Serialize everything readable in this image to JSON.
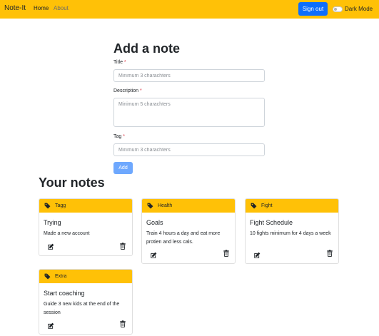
{
  "navbar": {
    "brand": "Note-It",
    "links": [
      "Home",
      "About"
    ],
    "signout_label": "Sign out",
    "dark_mode_label": "Dark Mode",
    "dark_mode_enabled": false
  },
  "form": {
    "heading": "Add a note",
    "title_label": "Title",
    "title_placeholder": "Minimum 3 charachters",
    "description_label": "Description",
    "description_placeholder": "Minimum 5 charachters",
    "tag_label": "Tag",
    "tag_placeholder": "Minimum 3 charachters",
    "required_mark": "*",
    "add_label": "Add"
  },
  "notes": {
    "heading": "Your notes",
    "items": [
      {
        "tag": "Tagg",
        "title": "Trying",
        "description": "Made a new account"
      },
      {
        "tag": "Health",
        "title": "Goals",
        "description": "Train 4 hours a day and eat more protien and less cals."
      },
      {
        "tag": "Fight",
        "title": "Fight Schedule",
        "description": "10 fights minimum for 4 days a week"
      },
      {
        "tag": "Extra",
        "title": "Start coaching",
        "description": "Guide 3 new kids at the end of the session"
      }
    ]
  },
  "colors": {
    "navbar": "#ffc107",
    "primary": "#0d6efd",
    "add_button": "#6ea8fe",
    "required": "#dc3545"
  },
  "icons": {
    "tag": "tag-icon",
    "edit": "edit-icon",
    "delete": "trash-icon"
  }
}
